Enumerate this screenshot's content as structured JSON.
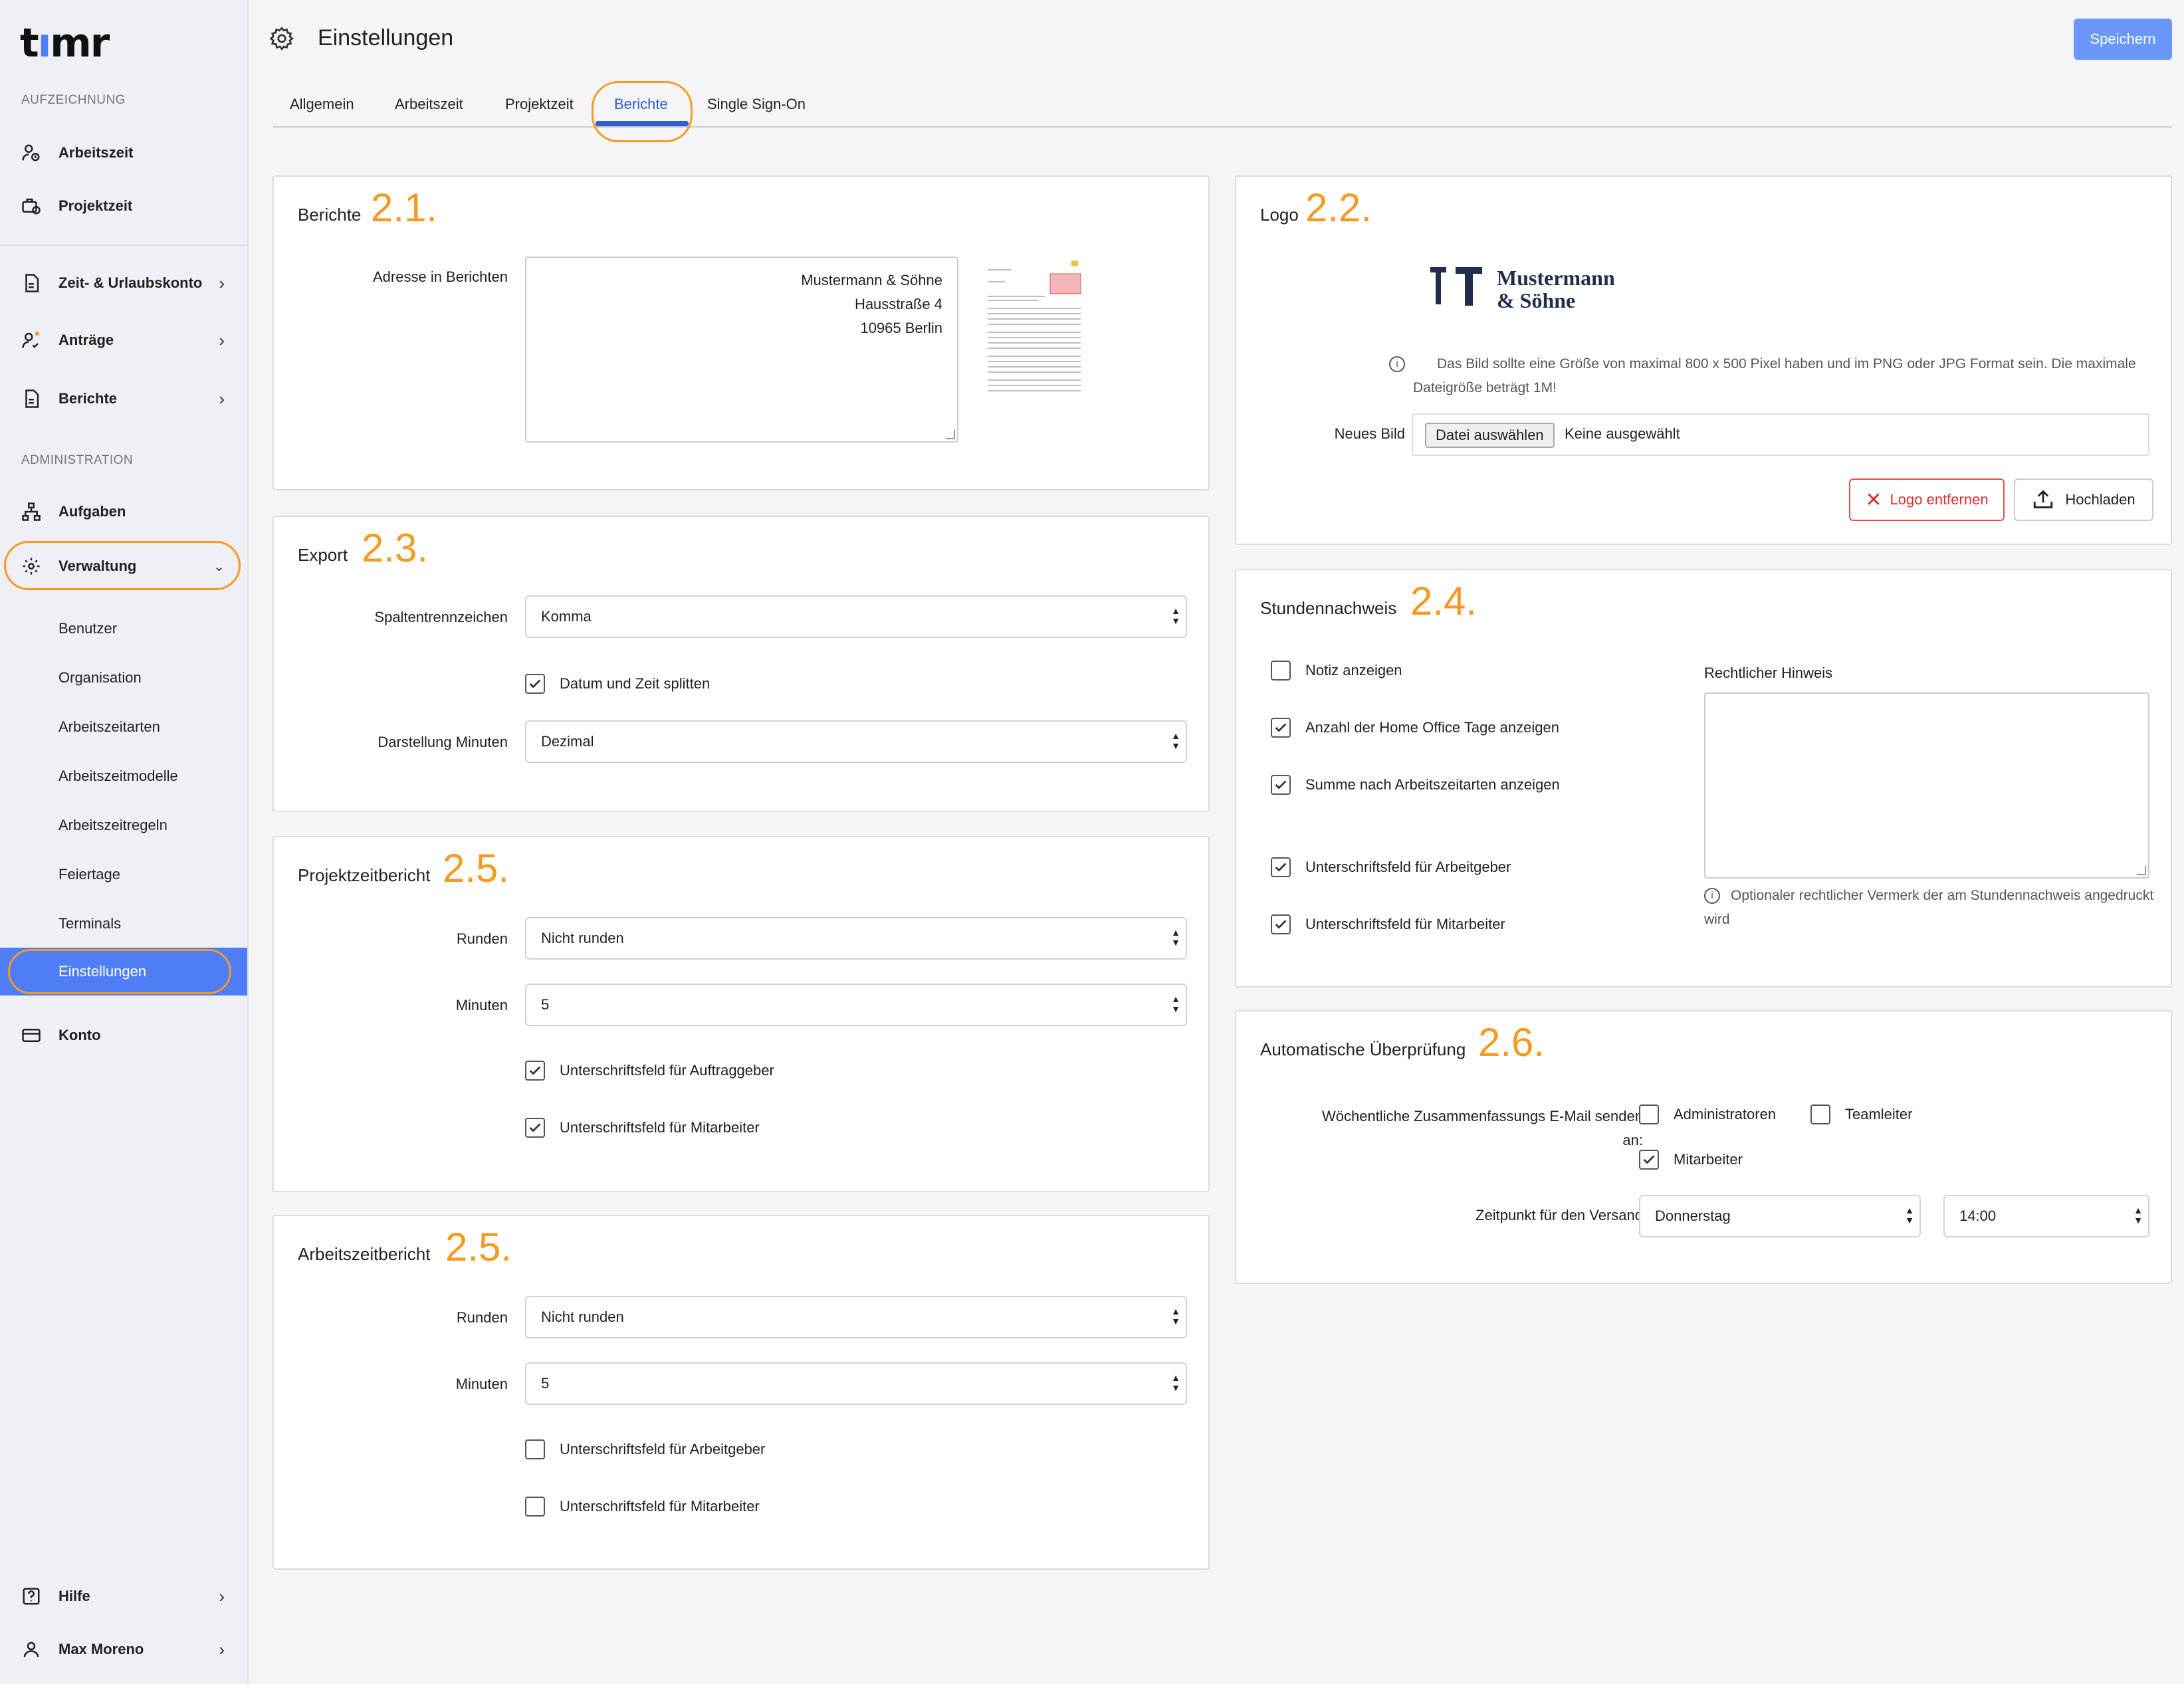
{
  "sidebar": {
    "logo": "timr",
    "section_recording": "AUFZEICHNUNG",
    "arbeitszeit": "Arbeitszeit",
    "projektzeit": "Projektzeit",
    "zeitkonto": "Zeit- & Urlaubskonto",
    "antraege": "Anträge",
    "berichte": "Berichte",
    "section_admin": "ADMINISTRATION",
    "aufgaben": "Aufgaben",
    "verwaltung": "Verwaltung",
    "sub": {
      "benutzer": "Benutzer",
      "organisation": "Organisation",
      "arbeitszeitarten": "Arbeitszeitarten",
      "arbeitszeitmodelle": "Arbeitszeitmodelle",
      "arbeitszeitregeln": "Arbeitszeitregeln",
      "feiertage": "Feiertage",
      "terminals": "Terminals",
      "einstellungen": "Einstellungen"
    },
    "konto": "Konto",
    "hilfe": "Hilfe",
    "user": "Max Moreno"
  },
  "header": {
    "title": "Einstellungen",
    "save": "Speichern"
  },
  "tabs": {
    "allgemein": "Allgemein",
    "arbeitszeit": "Arbeitszeit",
    "projektzeit": "Projektzeit",
    "berichte": "Berichte",
    "sso": "Single Sign-On"
  },
  "berichte": {
    "title": "Berichte",
    "num": "2.1.",
    "address_label": "Adresse in Berichten",
    "addr1": "Mustermann & Söhne",
    "addr2": "Hausstraße 4",
    "addr3": "10965 Berlin"
  },
  "logo": {
    "title": "Logo",
    "num": "2.2.",
    "brand1": "Mustermann",
    "brand2": "& Söhne",
    "info": "Das Bild sollte eine Größe von maximal 800 x 500 Pixel haben und im PNG oder JPG Format sein. Die maximale Dateigröße beträgt 1M!",
    "new_image_label": "Neues Bild",
    "choose_file": "Datei auswählen",
    "no_file": "Keine ausgewählt",
    "remove": "Logo entfernen",
    "upload": "Hochladen"
  },
  "export": {
    "title": "Export",
    "num": "2.3.",
    "sep_label": "Spaltentrennzeichen",
    "sep_value": "Komma",
    "split_label": "Datum und Zeit splitten",
    "min_label": "Darstellung Minuten",
    "min_value": "Dezimal"
  },
  "stunden": {
    "title": "Stundennachweis",
    "num": "2.4.",
    "notiz": "Notiz anzeigen",
    "homeoffice": "Anzahl der Home Office Tage anzeigen",
    "summe": "Summe nach Arbeitszeitarten anzeigen",
    "arbeitgeber": "Unterschriftsfeld für Arbeitgeber",
    "mitarbeiter": "Unterschriftsfeld für Mitarbeiter",
    "legal_label": "Rechtlicher Hinweis",
    "legal_info": "Optionaler rechtlicher Vermerk der am Stundennachweis angedruckt wird"
  },
  "projekt": {
    "title": "Projektzeitbericht",
    "num": "2.5.",
    "runden_label": "Runden",
    "runden_value": "Nicht runden",
    "minuten_label": "Minuten",
    "minuten_value": "5",
    "auftraggeber": "Unterschriftsfeld für Auftraggeber",
    "mitarbeiter": "Unterschriftsfeld für Mitarbeiter"
  },
  "auto": {
    "title": "Automatische Überprüfung",
    "num": "2.6.",
    "weekly_label1": "Wöchentliche Zusammenfassungs E-Mail senden",
    "weekly_label2": "an:",
    "admins": "Administratoren",
    "teamleiter": "Teamleiter",
    "mitarbeiter": "Mitarbeiter",
    "time_label": "Zeitpunkt für den Versand",
    "day_value": "Donnerstag",
    "time_value": "14:00"
  },
  "arbeitszeit": {
    "title": "Arbeitszeitbericht",
    "num": "2.5.",
    "runden_label": "Runden",
    "runden_value": "Nicht runden",
    "minuten_label": "Minuten",
    "minuten_value": "5",
    "arbeitgeber": "Unterschriftsfeld für Arbeitgeber",
    "mitarbeiter": "Unterschriftsfeld für Mitarbeiter"
  }
}
